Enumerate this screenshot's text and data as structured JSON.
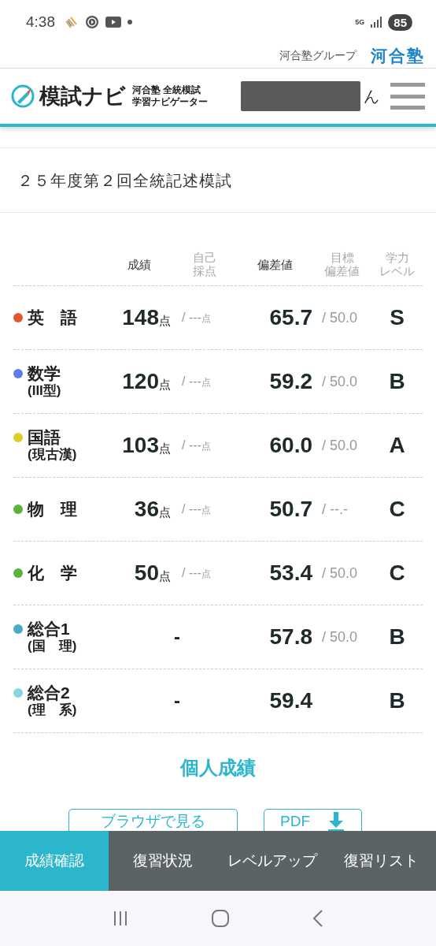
{
  "status_bar": {
    "time": "4:38",
    "network": "5G",
    "battery": "85"
  },
  "group_header": {
    "label": "河合塾グループ",
    "brand": "河合塾"
  },
  "nav": {
    "logo_title": "模試ナビ",
    "logo_sub": [
      "河合塾 全統模試",
      "学習ナビゲーター"
    ],
    "user_suffix": "ん"
  },
  "exam_title": "２５年度第２回全統記述模試",
  "table": {
    "columns": [
      {
        "lines": [
          "成績"
        ],
        "muted": false
      },
      {
        "lines": [
          "自己",
          "採点"
        ],
        "muted": true
      },
      {
        "lines": [
          "偏差値"
        ],
        "muted": false
      },
      {
        "lines": [
          "目標",
          "偏差値"
        ],
        "muted": true
      },
      {
        "lines": [
          "学力",
          "レベル"
        ],
        "muted": true
      }
    ],
    "rows": [
      {
        "color": "#e2572c",
        "subject": "英　語",
        "score": "148",
        "score_unit": "点",
        "self_score": "/ ---",
        "self_unit": "点",
        "deviation": "65.7",
        "target": "/ 50.0",
        "level": "S"
      },
      {
        "color": "#5b7fe8",
        "subject": "数学",
        "note": "(III型)",
        "score": "120",
        "score_unit": "点",
        "self_score": "/ ---",
        "self_unit": "点",
        "deviation": "59.2",
        "target": "/ 50.0",
        "level": "B"
      },
      {
        "color": "#dccf2a",
        "subject": "国語",
        "note": "(現古漢)",
        "score": "103",
        "score_unit": "点",
        "self_score": "/ ---",
        "self_unit": "点",
        "deviation": "60.0",
        "target": "/ 50.0",
        "level": "A"
      },
      {
        "color": "#5ab43c",
        "subject": "物　理",
        "score": "36",
        "score_unit": "点",
        "self_score": "/ ---",
        "self_unit": "点",
        "deviation": "50.7",
        "target": "/ --.-",
        "level": "C"
      },
      {
        "color": "#5ab43c",
        "subject": "化　学",
        "score": "50",
        "score_unit": "点",
        "self_score": "/ ---",
        "self_unit": "点",
        "deviation": "53.4",
        "target": "/ 50.0",
        "level": "C"
      },
      {
        "color": "#4aa8c8",
        "subject": "総合1",
        "note": "(国　理)",
        "score": "-",
        "deviation": "57.8",
        "target": "/ 50.0",
        "level": "B"
      },
      {
        "color": "#8ad6e0",
        "subject": "総合2",
        "note": "(理　系)",
        "score": "-",
        "deviation": "59.4",
        "level": "B"
      }
    ]
  },
  "section_title": "個人成績",
  "buttons": [
    {
      "label": "ブラウザで見る",
      "kind": "plain"
    },
    {
      "label": "PDF",
      "kind": "download"
    }
  ],
  "tabs": [
    {
      "label": "成績確認",
      "selected": true
    },
    {
      "label": "復習状況",
      "selected": false
    },
    {
      "label": "レベルアップ",
      "selected": false
    },
    {
      "label": "復習リスト",
      "selected": false
    }
  ]
}
